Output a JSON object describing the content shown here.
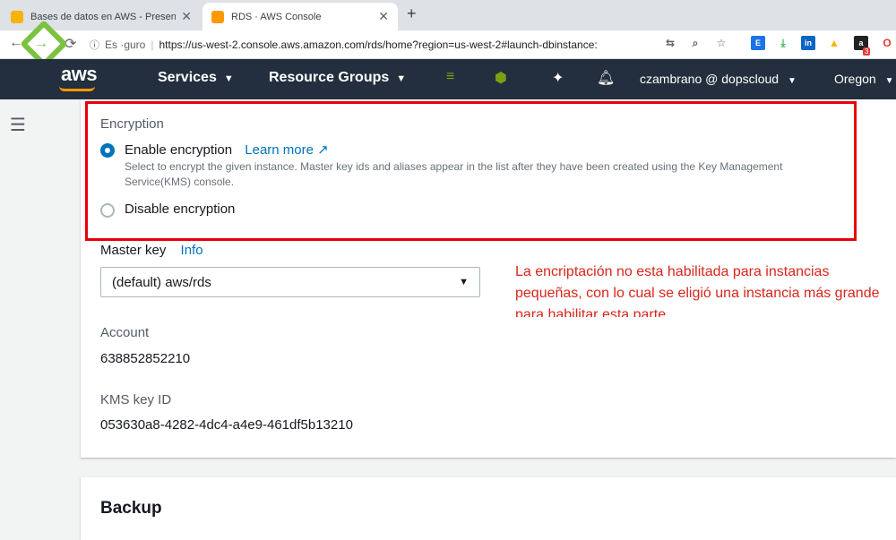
{
  "browser": {
    "tabs": [
      {
        "title": "Bases de datos en AWS - Presen",
        "color": "#f4b400",
        "active": false
      },
      {
        "title": "RDS · AWS Console",
        "color": "#ff9900",
        "active": true
      }
    ],
    "new_tab": "+",
    "omnibox": {
      "security": "Es ·guro",
      "url": "https://us-west-2.console.aws.amazon.com/rds/home?region=us-west-2#launch-dbinstance:"
    },
    "extension_badge": "3"
  },
  "aws_header": {
    "logo": "aws",
    "services": "Services",
    "resource_groups": "Resource Groups",
    "user": "czambrano @ dopscloud",
    "region": "Oregon"
  },
  "encryption": {
    "heading": "Encryption",
    "enable_label": "Enable encryption",
    "learn_more": "Learn more",
    "enable_desc": "Select to encrypt the given instance. Master key ids and aliases appear in the list after they have been created using the Key Management Service(KMS) console.",
    "disable_label": "Disable encryption"
  },
  "master_key": {
    "label": "Master key",
    "info": "Info",
    "selected": "(default) aws/rds"
  },
  "account": {
    "label": "Account",
    "value": "638852852210"
  },
  "kms": {
    "label": "KMS key ID",
    "value": "053630a8-4282-4dc4-a4e9-461df5b13210"
  },
  "annotation": "La encriptación no esta habilitada para instancias pequeñas, con lo cual se eligió una instancia más grande para habilitar esta parte",
  "backup": {
    "title": "Backup"
  },
  "colors": {
    "aws_header": "#232f3e",
    "aws_orange": "#ff9900",
    "link": "#0073bb",
    "highlight": "#e8000b",
    "annotation": "#d9261c"
  }
}
